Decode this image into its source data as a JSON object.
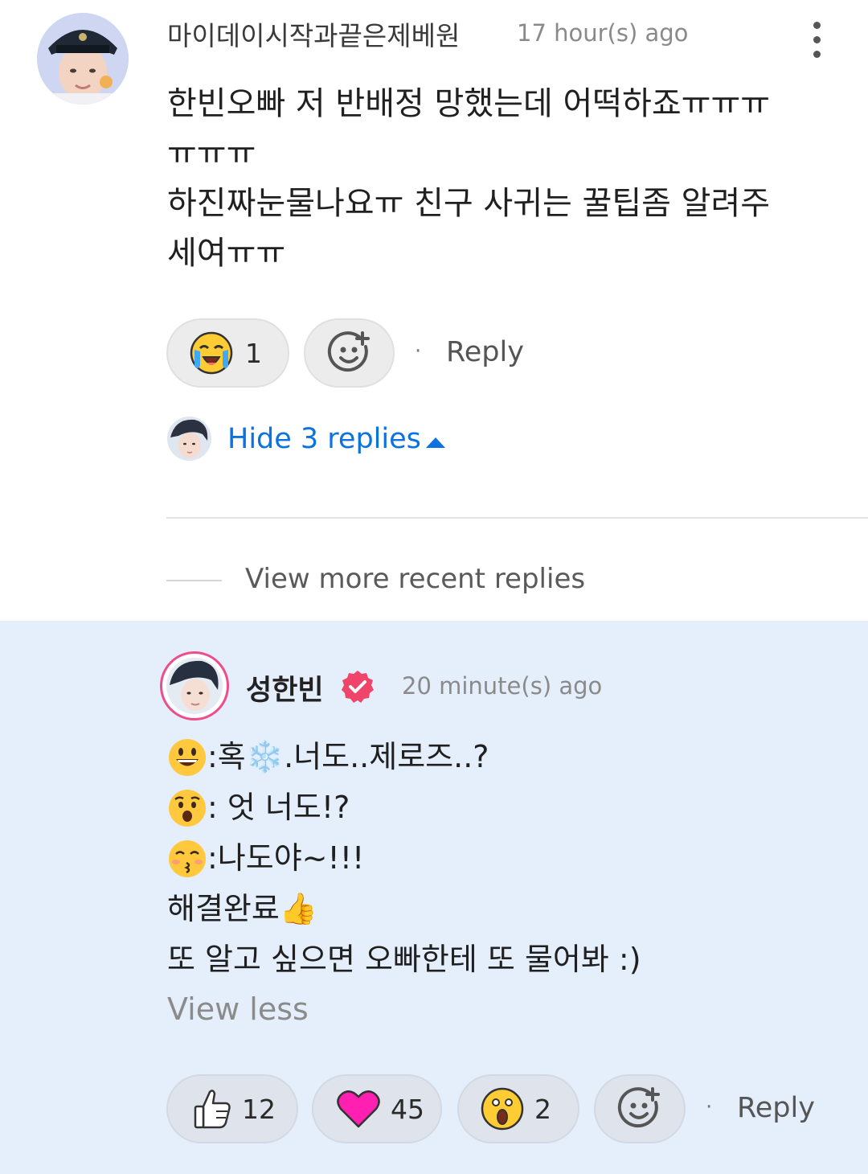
{
  "comment": {
    "username": "마이데이시작과끝은제베원",
    "timestamp": "17 hour(s) ago",
    "body_lines": [
      "한빈오빠 저 반배정 망했는데 어떡하죠ㅠㅠㅠ",
      "ㅠㅠㅠ",
      "하진짜눈물나요ㅠ 친구 사귀는 꿀팁좀 알려주",
      "세여ㅠㅠ"
    ],
    "reaction_count": "1",
    "reply_label": "Reply",
    "separator": "·",
    "hide_replies": "Hide 3 replies",
    "view_more": "View more recent replies"
  },
  "reply": {
    "username": "성한빈",
    "timestamp": "20 minute(s) ago",
    "lines": [
      {
        "emoji": "smile",
        "text": ":혹❄️.너도..제로즈..?"
      },
      {
        "emoji": "surprised",
        "text": ": 엇 너도!?"
      },
      {
        "emoji": "kiss",
        "text": ":나도야~!!!"
      },
      {
        "emoji": "thumbs-up",
        "text": "해결완료👍"
      },
      {
        "emoji": "",
        "text": "또 알고 싶으면 오빠한테 또 물어봐 :)"
      }
    ],
    "view_less": "View less",
    "reactions": {
      "like": "12",
      "heart": "45",
      "wow": "2"
    },
    "reply_label": "Reply",
    "separator": "·"
  },
  "colors": {
    "link_blue": "#0b73e0",
    "reply_bg": "#e5eefb",
    "verified_pink": "#f0456a",
    "heart_magenta": "#ff1fb0"
  }
}
